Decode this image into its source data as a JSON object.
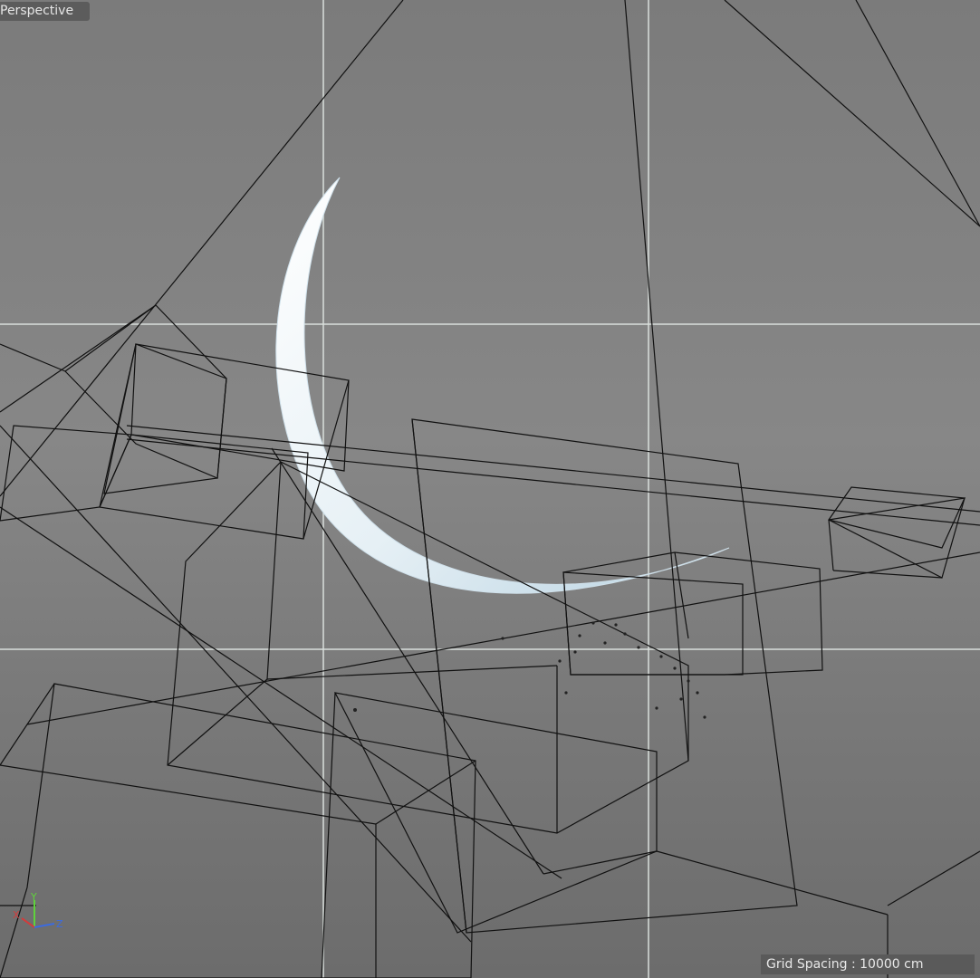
{
  "viewport": {
    "view_name": "Perspective",
    "grid_spacing_text": "Grid Spacing : 10000 cm"
  },
  "axis_gizmo": {
    "x_label": "X",
    "y_label": "Y",
    "z_label": "Z",
    "x_color": "#d23c3c",
    "y_color": "#5fd23c",
    "z_color": "#3c6be0"
  },
  "colors": {
    "background_top": "#7b7b7b",
    "background_bottom": "#6c6c6c",
    "grid_line": "#d8dedb",
    "wireframe": "#111111",
    "moon_light": "#ffffff",
    "moon_shadow": "#bcd6e4"
  }
}
